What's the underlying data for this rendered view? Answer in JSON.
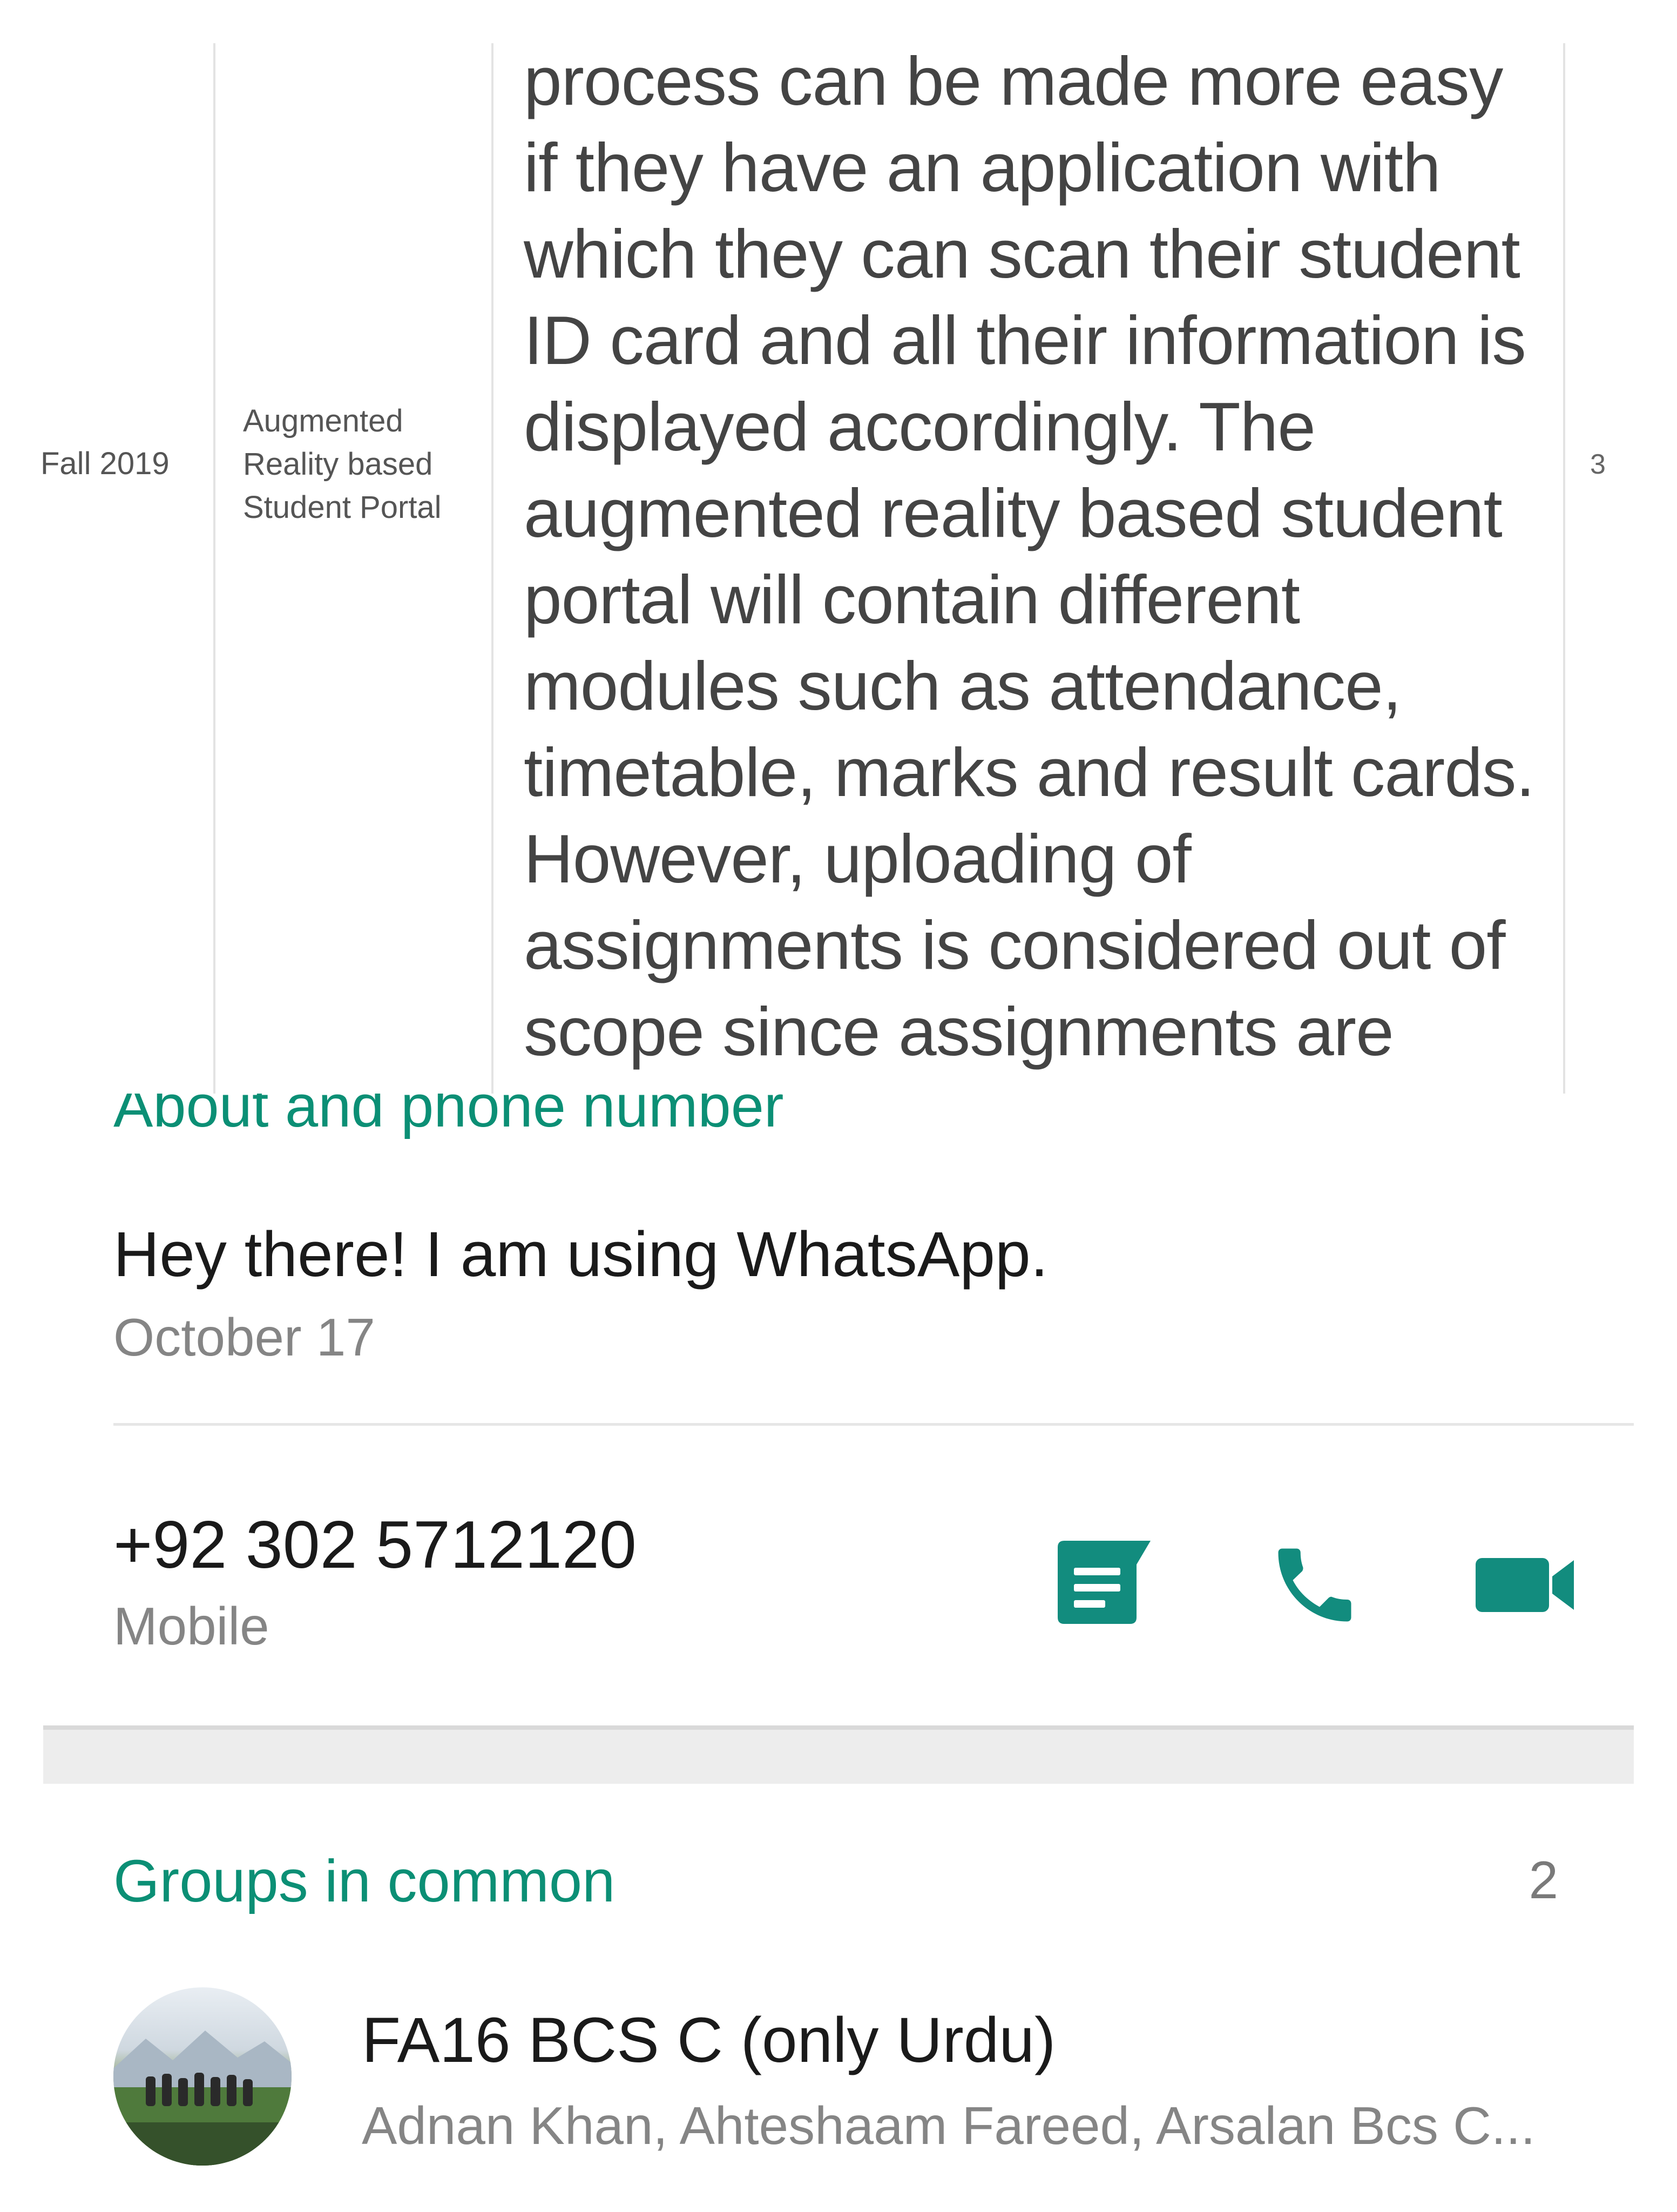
{
  "table": {
    "semester": "Fall 2019",
    "title_lines": [
      "Augmented",
      "Reality based",
      "Student Portal"
    ],
    "description_lines": [
      "process can be made more easy",
      "if they have an application with",
      "which they can scan their student",
      "ID card and all their information is",
      "displayed accordingly. The",
      "augmented reality based student",
      "portal will contain different",
      "modules such as attendance,",
      "timetable, marks and result cards.",
      "However, uploading of",
      "assignments is considered out of",
      "scope since assignments are"
    ],
    "count": "3"
  },
  "about": {
    "header": "About and phone number",
    "status": "Hey there! I am using WhatsApp.",
    "date": "October 17"
  },
  "phone": {
    "number": "+92 302 5712120",
    "type": "Mobile"
  },
  "actions": {
    "message_icon": "message-icon",
    "call_icon": "phone-icon",
    "video_icon": "video-call-icon"
  },
  "groups": {
    "title": "Groups in common",
    "count": "2",
    "items": [
      {
        "name": "FA16 BCS C (only Urdu)",
        "members": "Adnan Khan, Ahteshaam Fareed, Arsalan Bcs C..."
      }
    ]
  },
  "colors": {
    "accent": "#0b8f75",
    "icon": "#128c7e",
    "text_primary": "#1a1a1a",
    "text_secondary": "#858585"
  }
}
